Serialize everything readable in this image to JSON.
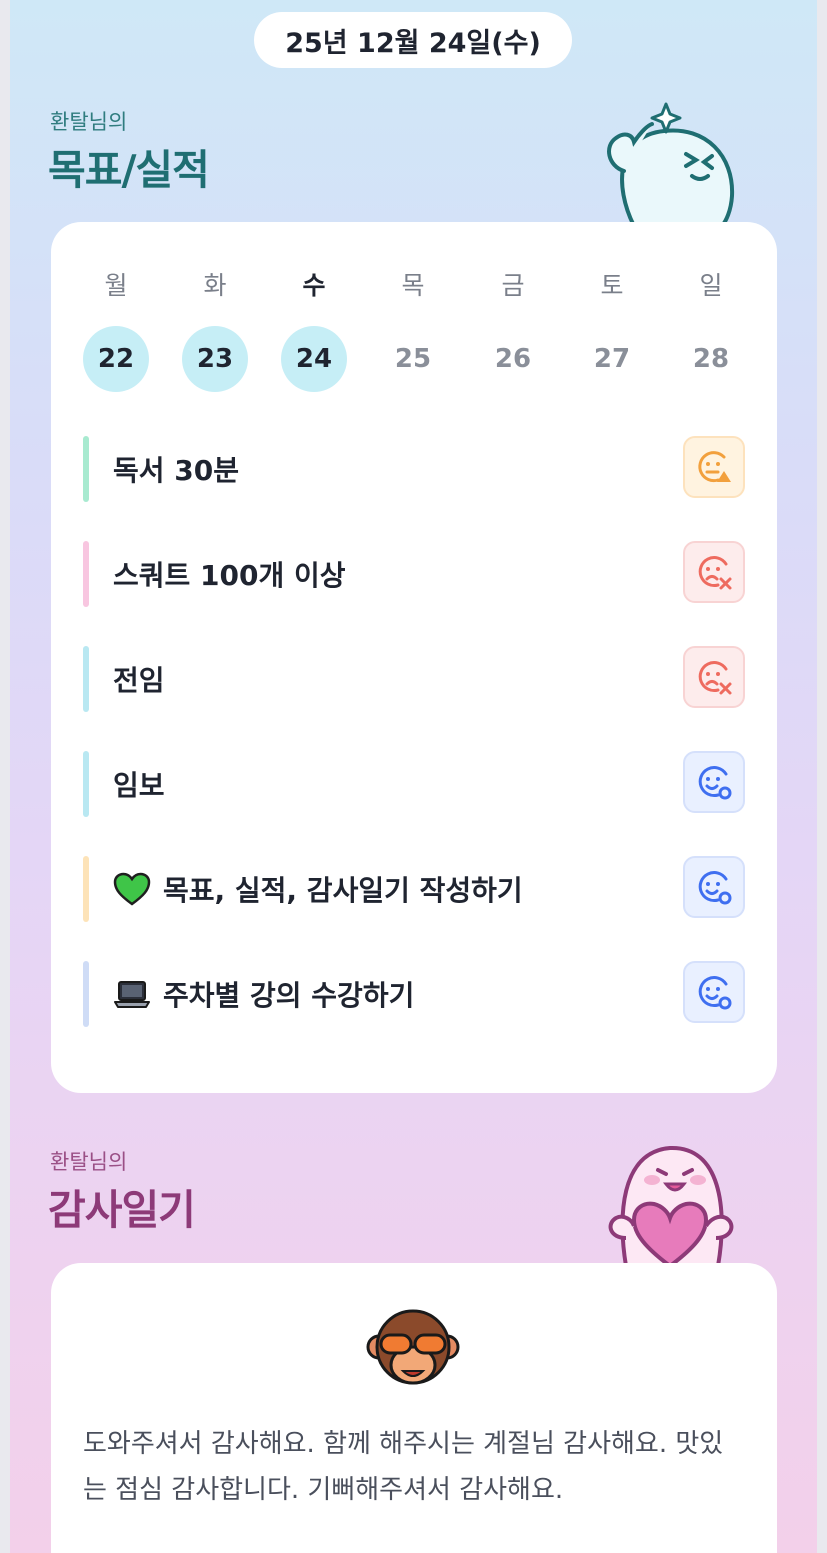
{
  "header": {
    "date": "25년 12월 24일(수)"
  },
  "goals_section": {
    "owner": "환탈님의",
    "title": "목표/실적"
  },
  "week": {
    "days": [
      {
        "weekday": "월",
        "date": "22",
        "active": true
      },
      {
        "weekday": "화",
        "date": "23",
        "active": true
      },
      {
        "weekday": "수",
        "date": "24",
        "active": true,
        "today": true
      },
      {
        "weekday": "목",
        "date": "25",
        "active": false
      },
      {
        "weekday": "금",
        "date": "26",
        "active": false
      },
      {
        "weekday": "토",
        "date": "27",
        "active": false
      },
      {
        "weekday": "일",
        "date": "28",
        "active": false
      }
    ]
  },
  "goals": [
    {
      "label": "독서 30분",
      "bar_color": "#a8ead0",
      "status": "partial"
    },
    {
      "label": "스쿼트 100개 이상",
      "bar_color": "#f8c6e0",
      "status": "fail"
    },
    {
      "label": "전임",
      "bar_color": "#b9e8f2",
      "status": "fail"
    },
    {
      "label": "임보",
      "bar_color": "#b9e8f2",
      "status": "done"
    },
    {
      "label": "목표, 실적, 감사일기 작성하기",
      "bar_color": "#fde3b8",
      "status": "done",
      "emoji": "green-heart-icon"
    },
    {
      "label": "주차별 강의 수강하기",
      "bar_color": "#cfdcf6",
      "status": "done",
      "emoji": "laptop-icon"
    }
  ],
  "status_colors": {
    "partial": "#f2a03d",
    "fail": "#ee6b5f",
    "done": "#3f6ff0"
  },
  "diary_section": {
    "owner": "환탈님의",
    "title": "감사일기",
    "icon": "see-no-evil-monkey-icon",
    "text": "도와주셔서 감사해요. 함께 해주시는 계절님 감사해요. 맛있는 점심 감사합니다. 기뻐해주셔서 감사해요."
  }
}
